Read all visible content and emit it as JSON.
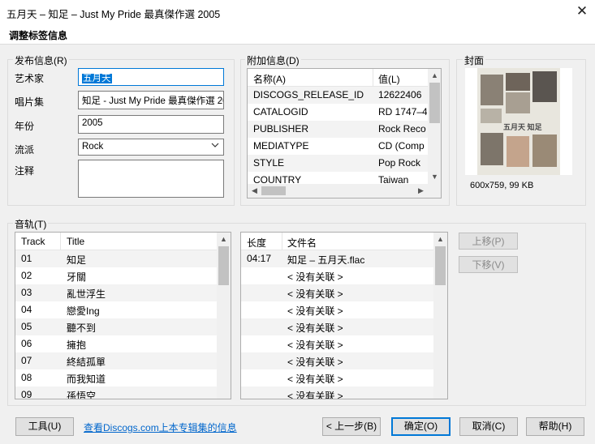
{
  "window": {
    "title": "五月天 – 知足 – Just My Pride 最真傑作選 2005",
    "close_glyph": "✕",
    "header": "调整标签信息"
  },
  "release_info": {
    "group_label": "发布信息(R)",
    "artist_label": "艺术家",
    "artist_value": "五月天",
    "album_label": "唱片集",
    "album_value": "知足 - Just My Pride 最真傑作選 2005",
    "year_label": "年份",
    "year_value": "2005",
    "genre_label": "流派",
    "genre_value": "Rock",
    "comment_label": "注释",
    "comment_value": ""
  },
  "extra_info": {
    "group_label": "附加信息(D)",
    "columns": [
      "名称(A)",
      "值(L)"
    ],
    "rows": [
      {
        "name": "DISCOGS_RELEASE_ID",
        "value": "12622406"
      },
      {
        "name": "CATALOGID",
        "value": "RD 1747–4"
      },
      {
        "name": "PUBLISHER",
        "value": "Rock Reco"
      },
      {
        "name": "MEDIATYPE",
        "value": "CD (Comp"
      },
      {
        "name": "STYLE",
        "value": "Pop Rock"
      },
      {
        "name": "COUNTRY",
        "value": "Taiwan"
      }
    ],
    "scroll_position": 0.0
  },
  "cover": {
    "group_label": "封面",
    "cover_title_text": "五月天 知足",
    "info": "600x759, 99 KB"
  },
  "tracks": {
    "group_label": "音轨(T)",
    "left_columns": [
      "Track",
      "Title"
    ],
    "right_columns": [
      "长度",
      "文件名"
    ],
    "rows": [
      {
        "track": "01",
        "title": "知足",
        "length": "04:17",
        "file": "知足 – 五月天.flac"
      },
      {
        "track": "02",
        "title": "牙關",
        "length": "",
        "file": "< 没有关联 >"
      },
      {
        "track": "03",
        "title": "亂世浮生",
        "length": "",
        "file": "< 没有关联 >"
      },
      {
        "track": "04",
        "title": "戀愛Ing",
        "length": "",
        "file": "< 没有关联 >"
      },
      {
        "track": "05",
        "title": "聽不到",
        "length": "",
        "file": "< 没有关联 >"
      },
      {
        "track": "06",
        "title": "擁抱",
        "length": "",
        "file": "< 没有关联 >"
      },
      {
        "track": "07",
        "title": "終結孤單",
        "length": "",
        "file": "< 没有关联 >"
      },
      {
        "track": "08",
        "title": "而我知道",
        "length": "",
        "file": "< 没有关联 >"
      },
      {
        "track": "09",
        "title": "孫悟空",
        "length": "",
        "file": "< 没有关联 >"
      }
    ],
    "move_up_label": "上移(P)",
    "move_down_label": "下移(V)"
  },
  "footer": {
    "tools_label": "工具(U)",
    "discogs_link": "查看Discogs.com上本专辑集的信息",
    "back_label": "< 上一步(B)",
    "ok_label": "确定(O)",
    "cancel_label": "取消(C)",
    "help_label": "帮助(H)"
  },
  "colors": {
    "accent": "#0078d7",
    "link": "#0066cc",
    "dialog_bg": "#f0f0f0"
  }
}
